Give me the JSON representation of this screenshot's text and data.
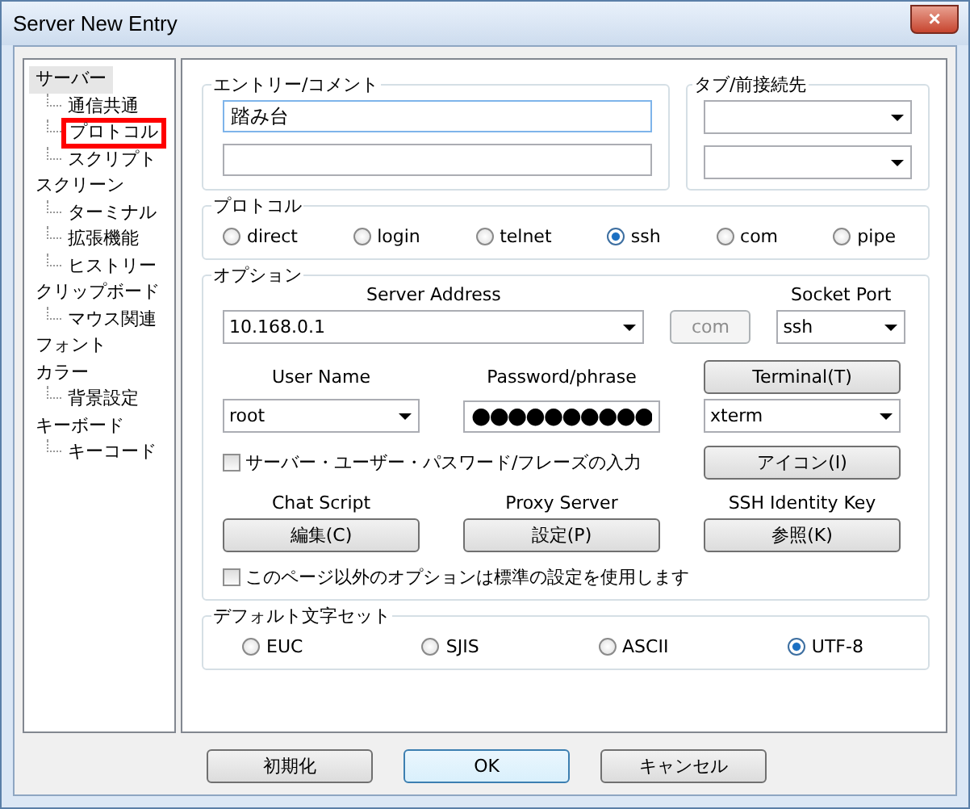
{
  "window": {
    "title": "Server New Entry",
    "close_label": "×"
  },
  "tree": [
    {
      "label": "サーバー",
      "selected": true,
      "marked": false,
      "children": [
        {
          "label": "通信共通",
          "selected": false,
          "marked": false
        },
        {
          "label": "プロトコル",
          "selected": false,
          "marked": true
        },
        {
          "label": "スクリプト",
          "selected": false,
          "marked": false
        }
      ]
    },
    {
      "label": "スクリーン",
      "selected": false,
      "marked": false,
      "children": [
        {
          "label": "ターミナル",
          "selected": false,
          "marked": false
        },
        {
          "label": "拡張機能",
          "selected": false,
          "marked": false
        },
        {
          "label": "ヒストリー",
          "selected": false,
          "marked": false
        }
      ]
    },
    {
      "label": "クリップボード",
      "selected": false,
      "marked": false,
      "children": [
        {
          "label": "マウス関連",
          "selected": false,
          "marked": false
        }
      ]
    },
    {
      "label": "フォント",
      "selected": false,
      "marked": false
    },
    {
      "label": "カラー",
      "selected": false,
      "marked": false,
      "children": [
        {
          "label": "背景設定",
          "selected": false,
          "marked": false
        }
      ]
    },
    {
      "label": "キーボード",
      "selected": false,
      "marked": false,
      "children": [
        {
          "label": "キーコード",
          "selected": false,
          "marked": false
        }
      ]
    }
  ],
  "entry": {
    "legend": "エントリー/コメント",
    "entry_value": "踏み台"
  },
  "tab": {
    "legend": "タブ/前接続先"
  },
  "protocol": {
    "legend": "プロトコル",
    "options": [
      {
        "label": "direct",
        "selected": false
      },
      {
        "label": "login",
        "selected": false
      },
      {
        "label": "telnet",
        "selected": false
      },
      {
        "label": "ssh",
        "selected": true
      },
      {
        "label": "com",
        "selected": false
      },
      {
        "label": "pipe",
        "selected": false
      }
    ]
  },
  "options": {
    "legend": "オプション",
    "server_address": {
      "label": "Server Address",
      "value": "10.168.0.1"
    },
    "com_button": {
      "label": "com",
      "disabled": true
    },
    "socket_port": {
      "label": "Socket Port",
      "value": "ssh"
    },
    "user_name": {
      "label": "User Name",
      "value": "root"
    },
    "password": {
      "label": "Password/phrase",
      "value": "●●●●●●●●●●"
    },
    "terminal_button": "Terminal(T)",
    "terminal_type": "xterm",
    "input_checkbox": {
      "label": "サーバー・ユーザー・パスワード/フレーズの入力",
      "checked": false
    },
    "icon_button": "アイコン(I)",
    "chat_script": {
      "label": "Chat Script",
      "button": "編集(C)"
    },
    "proxy_server": {
      "label": "Proxy Server",
      "button": "設定(P)"
    },
    "ssh_identity_key": {
      "label": "SSH Identity Key",
      "button": "参照(K)"
    },
    "default_checkbox": {
      "label": "このページ以外のオプションは標準の設定を使用します",
      "checked": false
    }
  },
  "charset": {
    "legend": "デフォルト文字セット",
    "options": [
      {
        "label": "EUC",
        "selected": false
      },
      {
        "label": "SJIS",
        "selected": false
      },
      {
        "label": "ASCII",
        "selected": false
      },
      {
        "label": "UTF-8",
        "selected": true
      }
    ]
  },
  "buttons": [
    {
      "label": "初期化",
      "default": false
    },
    {
      "label": "OK",
      "default": true
    },
    {
      "label": "キャンセル",
      "default": false
    }
  ]
}
